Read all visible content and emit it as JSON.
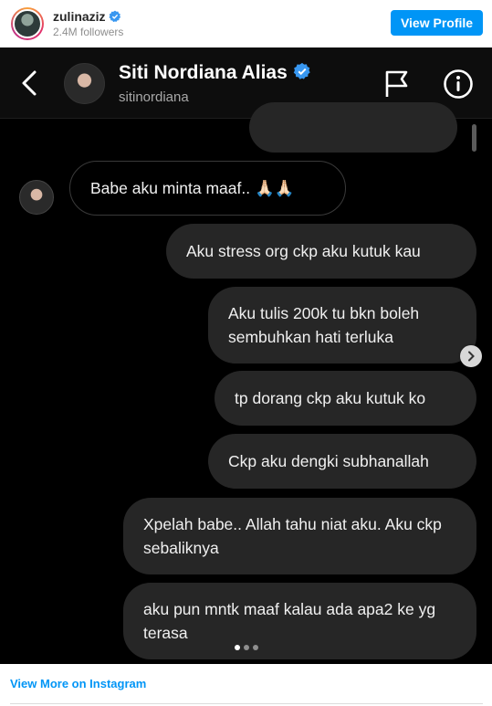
{
  "embed_header": {
    "username": "zulinaziz",
    "followers": "2.4M followers",
    "view_profile_label": "View Profile"
  },
  "dm": {
    "contact_name": "Siti Nordiana Alias",
    "contact_handle": "sitinordiana",
    "messages": [
      {
        "direction": "incoming",
        "text": "Babe aku minta maaf.. 🙏🏻🙏🏻"
      },
      {
        "direction": "outgoing",
        "text": "Aku stress org ckp aku kutuk kau"
      },
      {
        "direction": "outgoing",
        "text": "Aku tulis 200k tu bkn boleh sembuhkan hati terluka"
      },
      {
        "direction": "outgoing",
        "text": "tp dorang ckp aku kutuk ko"
      },
      {
        "direction": "outgoing",
        "text": "Ckp aku dengki subhanallah"
      },
      {
        "direction": "outgoing",
        "text": "Xpelah babe.. Allah tahu niat aku. Aku ckp sebaliknya"
      },
      {
        "direction": "outgoing",
        "text": "aku pun mntk maaf kalau ada apa2 ke yg terasa"
      }
    ],
    "carousel": {
      "total": 3,
      "active": 1
    }
  },
  "footer": {
    "view_more_label": "View More on Instagram"
  },
  "colors": {
    "accent": "#0095f6",
    "verified": "#3897f0",
    "bubble": "#262626",
    "dm_background": "#000000"
  }
}
